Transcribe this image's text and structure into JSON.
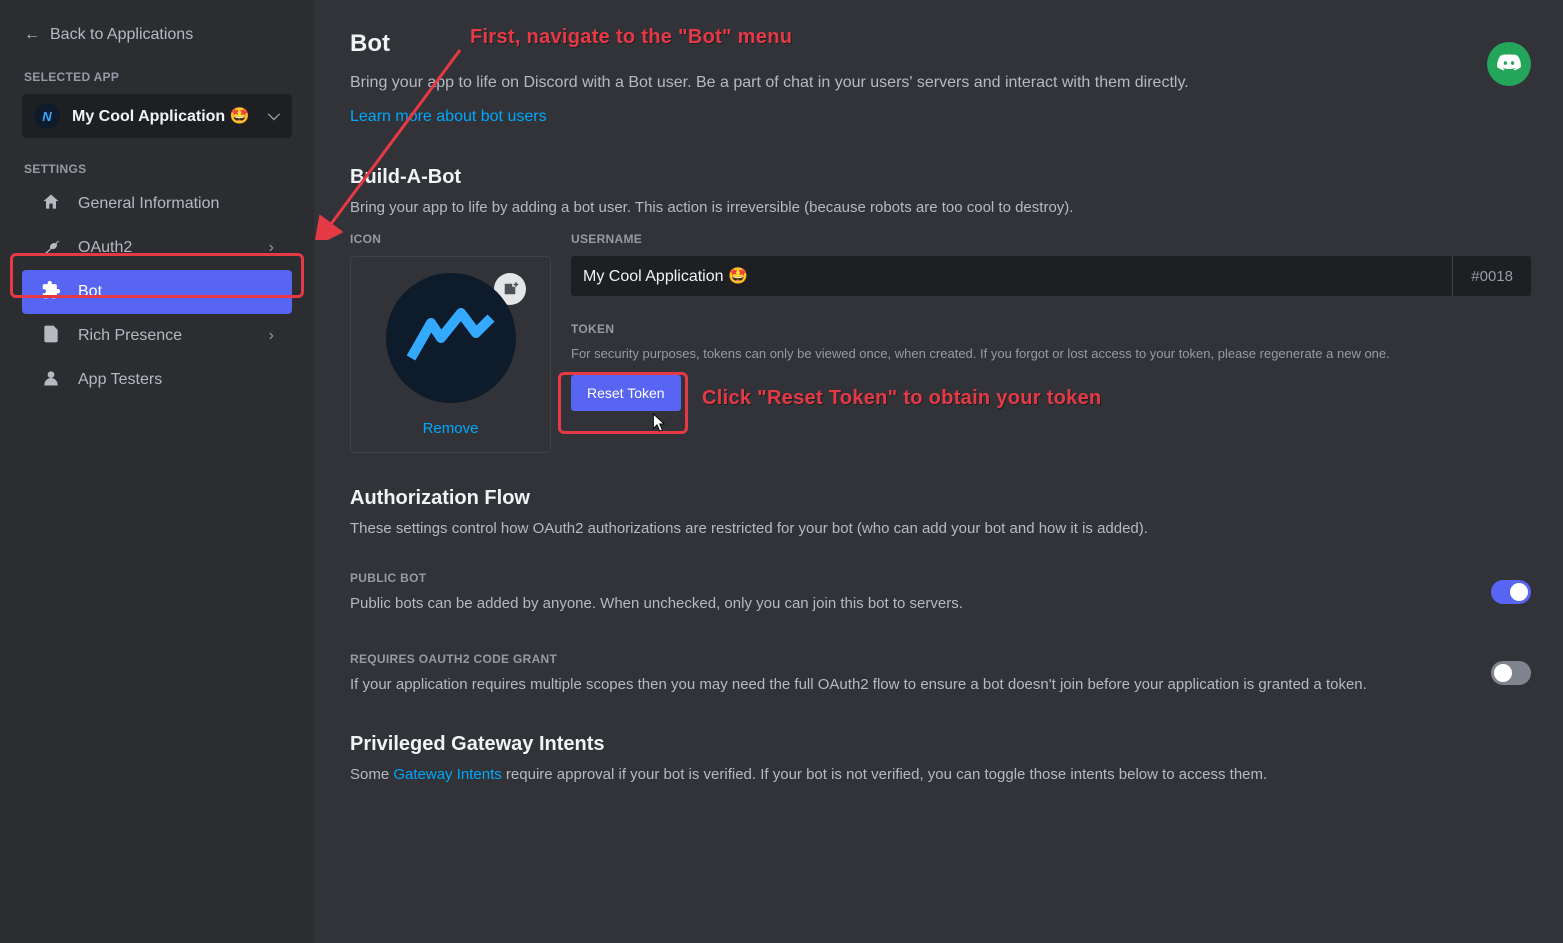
{
  "sidebar": {
    "back": "Back to Applications",
    "selected_app_label": "SELECTED APP",
    "app_name": "My Cool Application 🤩",
    "settings_label": "SETTINGS",
    "items": [
      {
        "label": "General Information"
      },
      {
        "label": "OAuth2"
      },
      {
        "label": "Bot"
      },
      {
        "label": "Rich Presence"
      },
      {
        "label": "App Testers"
      }
    ]
  },
  "page": {
    "title": "Bot",
    "subtitle": "Bring your app to life on Discord with a Bot user. Be a part of chat in your users' servers and interact with them directly.",
    "learn_more": "Learn more about bot users",
    "build_title": "Build-A-Bot",
    "build_desc": "Bring your app to life by adding a bot user. This action is irreversible (because robots are too cool to destroy).",
    "icon_label": "ICON",
    "remove": "Remove",
    "username_label": "USERNAME",
    "username_value": "My Cool Application 🤩",
    "discriminator": "#0018",
    "token_label": "TOKEN",
    "token_note": "For security purposes, tokens can only be viewed once, when created. If you forgot or lost access to your token, please regenerate a new one.",
    "reset_token": "Reset Token",
    "auth_flow_title": "Authorization Flow",
    "auth_flow_desc": "These settings control how OAuth2 authorizations are restricted for your bot (who can add your bot and how it is added).",
    "public_bot_label": "PUBLIC BOT",
    "public_bot_desc": "Public bots can be added by anyone. When unchecked, only you can join this bot to servers.",
    "oauth_grant_label": "REQUIRES OAUTH2 CODE GRANT",
    "oauth_grant_desc": "If your application requires multiple scopes then you may need the full OAuth2 flow to ensure a bot doesn't join before your application is granted a token.",
    "intents_title": "Privileged Gateway Intents",
    "intents_desc_pre": "Some ",
    "intents_desc_link": "Gateway Intents",
    "intents_desc_post": " require approval if your bot is verified. If your bot is not verified, you can toggle those intents below to access them."
  },
  "annotations": {
    "first": "First, navigate to the \"Bot\" menu",
    "second": "Click \"Reset Token\" to obtain your token"
  }
}
